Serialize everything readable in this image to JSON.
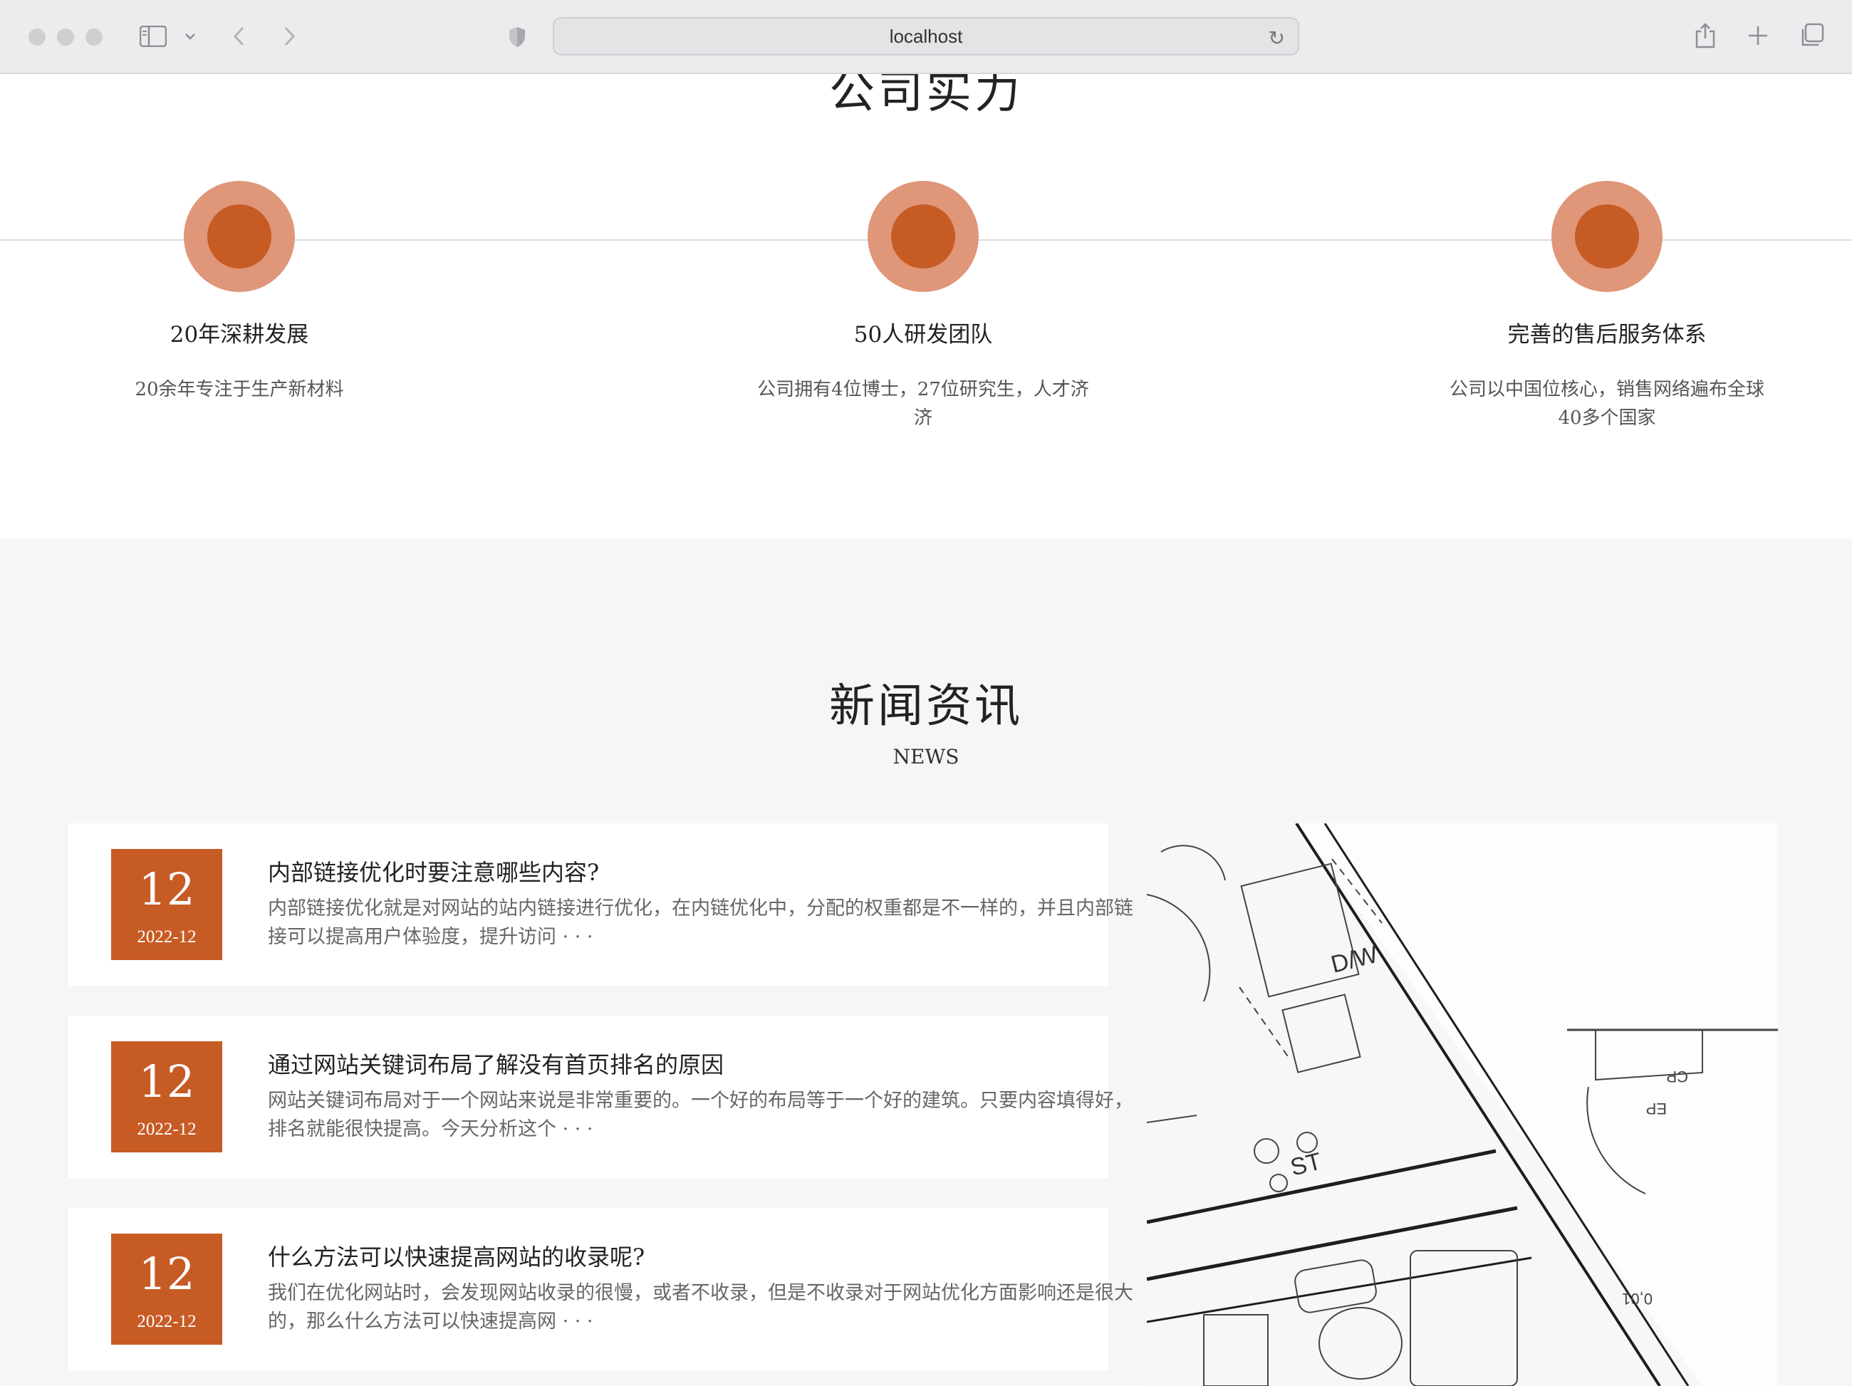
{
  "browser": {
    "url": "localhost"
  },
  "strength": {
    "title": "公司实力",
    "items": [
      {
        "title": "20年深耕发展",
        "desc": "20余年专注于生产新材料"
      },
      {
        "title": "50人研发团队",
        "desc": "公司拥有4位博士，27位研究生，人才济济"
      },
      {
        "title": "完善的售后服务体系",
        "desc": "公司以中国位核心，销售网络遍布全球40多个国家"
      }
    ]
  },
  "news": {
    "title": "新闻资讯",
    "subtitle": "NEWS",
    "items": [
      {
        "day": "12",
        "ym": "2022-12",
        "headline": "内部链接优化时要注意哪些内容?",
        "summary": "内部链接优化就是对网站的站内链接进行优化，在内链优化中，分配的权重都是不一样的，并且内部链接可以提高用户体验度，提升访问 · · ·"
      },
      {
        "day": "12",
        "ym": "2022-12",
        "headline": "通过网站关键词布局了解没有首页排名的原因",
        "summary": "网站关键词布局对于一个网站来说是非常重要的。一个好的布局等于一个好的建筑。只要内容填得好，排名就能很快提高。今天分析这个 · · ·"
      },
      {
        "day": "12",
        "ym": "2022-12",
        "headline": "什么方法可以快速提高网站的收录呢?",
        "summary": "我们在优化网站时，会发现网站收录的很慢，或者不收录，但是不收录对于网站优化方面影响还是很大的，那么什么方法可以快速提高网 · · ·"
      }
    ],
    "image_labels": {
      "dw": "D/W",
      "st": "ST",
      "cp": "CP",
      "ep": "EP",
      "dim": "0,01"
    }
  }
}
